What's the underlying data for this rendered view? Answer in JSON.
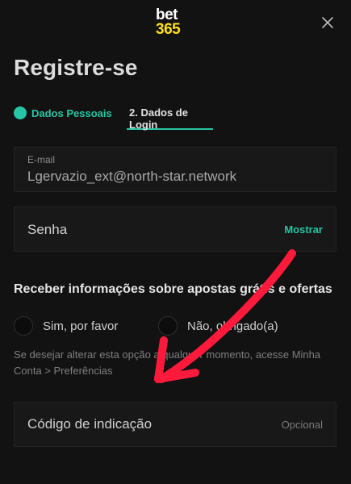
{
  "header": {
    "logo_top": "bet",
    "logo_bottom": "365",
    "close_icon": "close-icon"
  },
  "page_title": "Registre-se",
  "steps": [
    {
      "label": "Dados Pessoais",
      "status": "completed"
    },
    {
      "label": "2.  Dados de Login",
      "status": "active"
    }
  ],
  "email": {
    "label": "E-mail",
    "value": "Lgervazio_ext@north-star.network"
  },
  "senha": {
    "label": "Senha",
    "toggle_label": "Mostrar"
  },
  "marketing": {
    "question": "Receber informações sobre apostas grátis e ofertas",
    "options": [
      {
        "label": "Sim, por favor"
      },
      {
        "label": "Não, obrigado(a)"
      }
    ],
    "hint": "Se desejar alterar esta opção a qualquer momento, acesse Minha Conta > Preferências"
  },
  "referral": {
    "label": "Código de indicação",
    "optional_label": "Opcional"
  },
  "colors": {
    "accent": "#26c6a5",
    "brand_yellow": "#ffdf1b",
    "background": "#121212",
    "annotation_arrow": "#ff1a3c"
  }
}
